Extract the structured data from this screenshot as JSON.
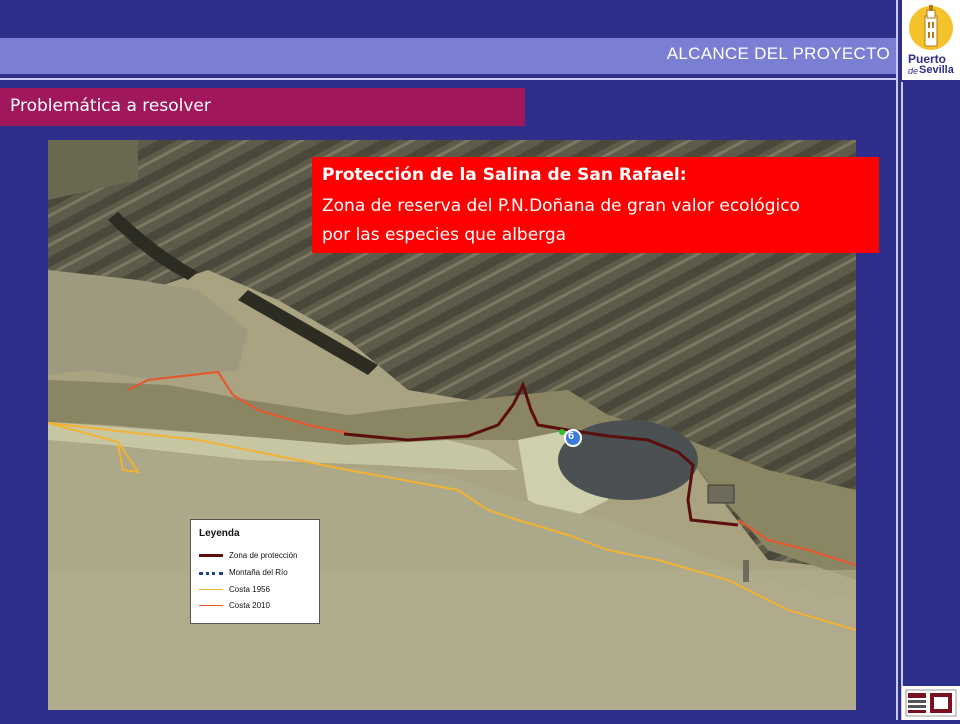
{
  "header": {
    "title": "ALCANCE DEL PROYECTO"
  },
  "section": {
    "title": "Problemática a resolver"
  },
  "logo": {
    "line1": "Puerto",
    "line2": "de",
    "line3": "Sevilla"
  },
  "callout": {
    "title": "Protección de la Salina de San Rafael:",
    "line1": "Zona de reserva del P.N.Doñana de gran valor ecológico",
    "line2": "por las especies que alberga"
  },
  "map": {
    "marker_label": "6",
    "legend": {
      "title": "Leyenda",
      "items": [
        {
          "label": "Zona de protección",
          "color": "#5a0e0e",
          "style": "thick"
        },
        {
          "label": "Montaña del Río",
          "color": "#1f3f8f",
          "style": "dotted"
        },
        {
          "label": "Costa 1956",
          "color": "#f2b233",
          "style": "thin"
        },
        {
          "label": "Costa 2010",
          "color": "#e8552b",
          "style": "thin"
        }
      ]
    }
  },
  "colors": {
    "background": "#2e2f8a",
    "header": "#7a7fd4",
    "section": "#a0175c",
    "callout": "#ff0000"
  }
}
